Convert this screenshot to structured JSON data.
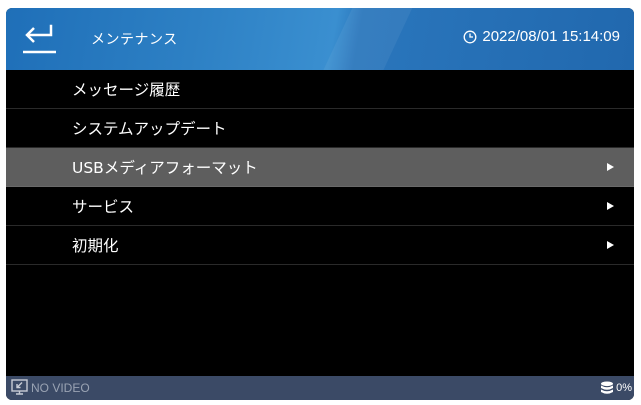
{
  "header": {
    "title": "メンテナンス",
    "datetime": "2022/08/01 15:14:09",
    "back_icon": "back-arrow-icon",
    "clock_icon": "clock-icon"
  },
  "menu": {
    "items": [
      {
        "label": "メッセージ履歴",
        "selected": false,
        "has_arrow": false
      },
      {
        "label": "システムアップデート",
        "selected": false,
        "has_arrow": false
      },
      {
        "label": "USBメディアフォーマット",
        "selected": true,
        "has_arrow": true
      },
      {
        "label": "サービス",
        "selected": false,
        "has_arrow": true
      },
      {
        "label": "初期化",
        "selected": false,
        "has_arrow": true
      }
    ]
  },
  "footer": {
    "video_status": "NO VIDEO",
    "storage_usage": "0%",
    "video_icon": "no-video-icon",
    "storage_icon": "database-icon"
  },
  "colors": {
    "header_bg": "#2a78be",
    "selected_row": "#5e5e5e",
    "footer_bg": "#3b4a66",
    "background": "#000000"
  }
}
